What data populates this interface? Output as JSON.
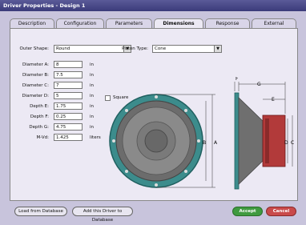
{
  "window": {
    "title": "Driver Properties - Design 1"
  },
  "tabs": [
    {
      "label": "Description"
    },
    {
      "label": "Configuration"
    },
    {
      "label": "Parameters"
    },
    {
      "label": "Dimensions"
    },
    {
      "label": "Response"
    },
    {
      "label": "External"
    }
  ],
  "form": {
    "outer_shape": {
      "label": "Outer Shape:",
      "value": "Round"
    },
    "piston_type": {
      "label": "Piston Type:",
      "value": "Cone"
    },
    "diameter_a": {
      "label": "Diameter A:",
      "value": "8",
      "unit": "in"
    },
    "diameter_b": {
      "label": "Diameter B:",
      "value": "7.5",
      "unit": "in"
    },
    "diameter_c": {
      "label": "Diameter C:",
      "value": "7",
      "unit": "in"
    },
    "diameter_d": {
      "label": "Diameter D:",
      "value": "5",
      "unit": "in"
    },
    "depth_e": {
      "label": "Depth E:",
      "value": "1.75",
      "unit": "in"
    },
    "depth_f": {
      "label": "Depth F:",
      "value": "0.25",
      "unit": "in"
    },
    "depth_g": {
      "label": "Depth G:",
      "value": "4.75",
      "unit": "in"
    },
    "mvd": {
      "label": "M-Vd:",
      "value": "1.425",
      "unit": "liters"
    },
    "square": {
      "label": "Square"
    }
  },
  "diagram": {
    "letters": [
      "A",
      "B",
      "C",
      "D",
      "E",
      "F",
      "G"
    ]
  },
  "buttons": {
    "load": "Load from Database",
    "add": "Add this Driver to Database",
    "accept": "Accept",
    "cancel": "Cancel"
  }
}
